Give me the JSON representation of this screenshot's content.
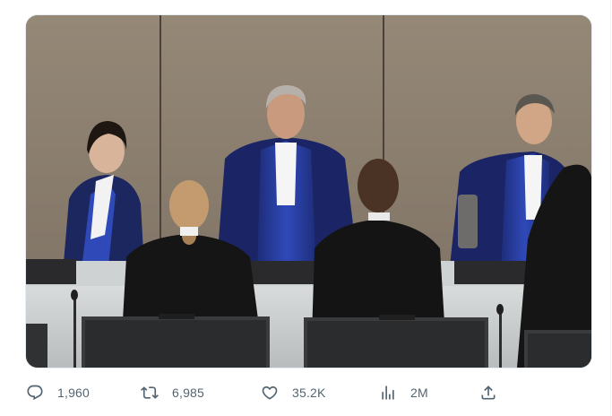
{
  "tweet": {
    "actions": {
      "reply": {
        "icon": "reply-icon",
        "count": "1,960"
      },
      "retweet": {
        "icon": "retweet-icon",
        "count": "6,985"
      },
      "like": {
        "icon": "heart-icon",
        "count": "35.2K"
      },
      "views": {
        "icon": "analytics-icon",
        "count": "2M"
      },
      "share": {
        "icon": "share-icon"
      }
    },
    "colors": {
      "action_icon": "#536471",
      "robe_blue": "#2f49b8",
      "robe_black": "#151515",
      "wall": "#8e8273"
    }
  }
}
